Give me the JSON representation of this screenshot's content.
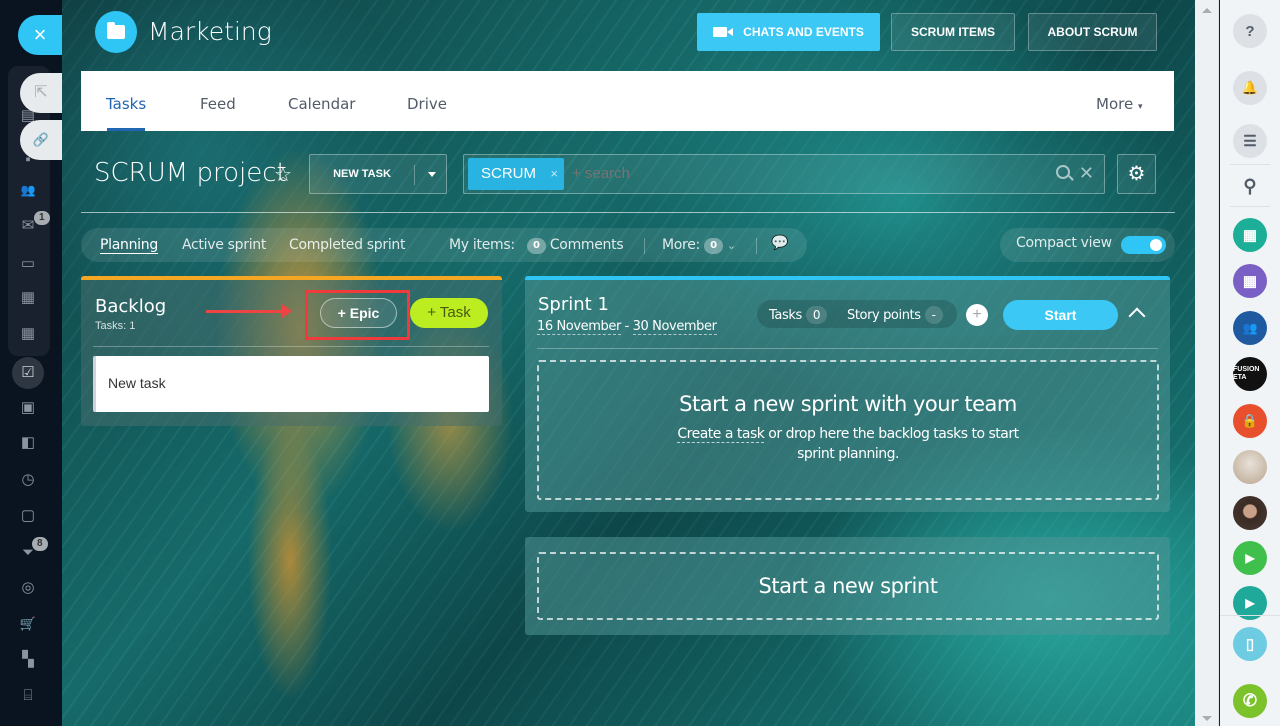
{
  "left_sidebar": {
    "close_icon": "×",
    "float_buttons": [
      {
        "name": "open-in-new-window",
        "glyph": "⇱"
      },
      {
        "name": "copy-link",
        "glyph": "🔗"
      }
    ],
    "items": [
      {
        "name": "calendar-window",
        "glyph": "▤"
      },
      {
        "name": "chat",
        "glyph": "▪"
      },
      {
        "name": "groups",
        "glyph": "👥"
      },
      {
        "name": "mail",
        "glyph": "✉",
        "badge": "1"
      },
      {
        "name": "drive",
        "glyph": "▭"
      },
      {
        "name": "documents",
        "glyph": "▦"
      },
      {
        "name": "calendar",
        "glyph": "▦"
      },
      {
        "name": "tasks",
        "glyph": "☑"
      },
      {
        "name": "contacts",
        "glyph": "▣"
      },
      {
        "name": "stream",
        "glyph": "◧"
      },
      {
        "name": "time",
        "glyph": "◷"
      },
      {
        "name": "sites",
        "glyph": "▢"
      },
      {
        "name": "crm",
        "glyph": "⏷",
        "badge": "8"
      },
      {
        "name": "marketing",
        "glyph": "◎"
      },
      {
        "name": "store",
        "glyph": "🛒"
      },
      {
        "name": "apps",
        "glyph": "▚"
      },
      {
        "name": "cash-register",
        "glyph": "⌸"
      }
    ]
  },
  "header": {
    "title": "Marketing",
    "buttons": {
      "chats_events": "CHATS AND EVENTS",
      "scrum_items": "SCRUM ITEMS",
      "about_scrum": "ABOUT SCRUM"
    }
  },
  "tabs": {
    "items": [
      "Tasks",
      "Feed",
      "Calendar",
      "Drive"
    ],
    "active": "Tasks",
    "more": "More"
  },
  "page": {
    "title": "SCRUM project",
    "new_task": "NEW TASK",
    "search": {
      "chip": "SCRUM",
      "placeholder": "+ search"
    }
  },
  "filters": {
    "planning": "Planning",
    "active_sprint": "Active sprint",
    "completed_sprint": "Completed sprint",
    "my_items": "My items:",
    "comments_count": "0",
    "comments": "Comments",
    "more": "More:",
    "more_count": "0",
    "compact_view": "Compact view",
    "compact_view_on": true
  },
  "backlog": {
    "title": "Backlog",
    "tasks_count": "Tasks: 1",
    "epic_button": "+ Epic",
    "task_button": "+ Task",
    "tasks": [
      "New task"
    ]
  },
  "sprint": {
    "title": "Sprint 1",
    "start_date": "16 November",
    "end_date": "30 November",
    "date_sep": " - ",
    "tasks_label": "Tasks",
    "tasks_value": "0",
    "story_points_label": "Story points",
    "story_points_value": "-",
    "start_button": "Start",
    "empty_title": "Start a new sprint with your team",
    "empty_link": "Create a task",
    "empty_text": " or drop here the backlog tasks to start sprint planning."
  },
  "new_sprint": {
    "label": "Start a new sprint"
  },
  "right_bar": {
    "items": [
      {
        "name": "help",
        "glyph": "?",
        "color": "#dde1e5"
      },
      {
        "name": "notifications",
        "glyph": "🔔",
        "color": "#dde1e5"
      },
      {
        "name": "messages",
        "glyph": "☰",
        "color": "#dde1e5"
      },
      {
        "name": "search",
        "glyph": "⚲",
        "color": ""
      },
      {
        "name": "calendar-green",
        "glyph": "▦",
        "color": "#1cae96"
      },
      {
        "name": "calendar-purple",
        "glyph": "▦",
        "color": "#7a5fc4"
      },
      {
        "name": "group-chat",
        "glyph": "👥",
        "color": "#1f5aa0"
      },
      {
        "name": "fusion-meta",
        "glyph": "FUSION ETA",
        "color": "#111111"
      },
      {
        "name": "lock",
        "glyph": "🔒",
        "color": "#e8502d"
      },
      {
        "name": "user-avatar-1",
        "glyph": "",
        "color": "#b9a58e"
      },
      {
        "name": "user-avatar-2",
        "glyph": "",
        "color": "#4a3a33"
      },
      {
        "name": "video-call-green",
        "glyph": "▶",
        "color": "#3fbf4b"
      },
      {
        "name": "video-call-teal",
        "glyph": "▶",
        "color": "#1ea99a"
      },
      {
        "name": "mobile-cloud",
        "glyph": "▯",
        "color": "#6dcbe2"
      },
      {
        "name": "phone",
        "glyph": "✆",
        "color": "#7cc22a"
      }
    ]
  },
  "colors": {
    "accent": "#2fc6f6",
    "task_green": "#bbed21",
    "backlog_bar": "#f5a623",
    "highlight_red": "#ef3b3b",
    "tab_active": "#2066b0"
  }
}
